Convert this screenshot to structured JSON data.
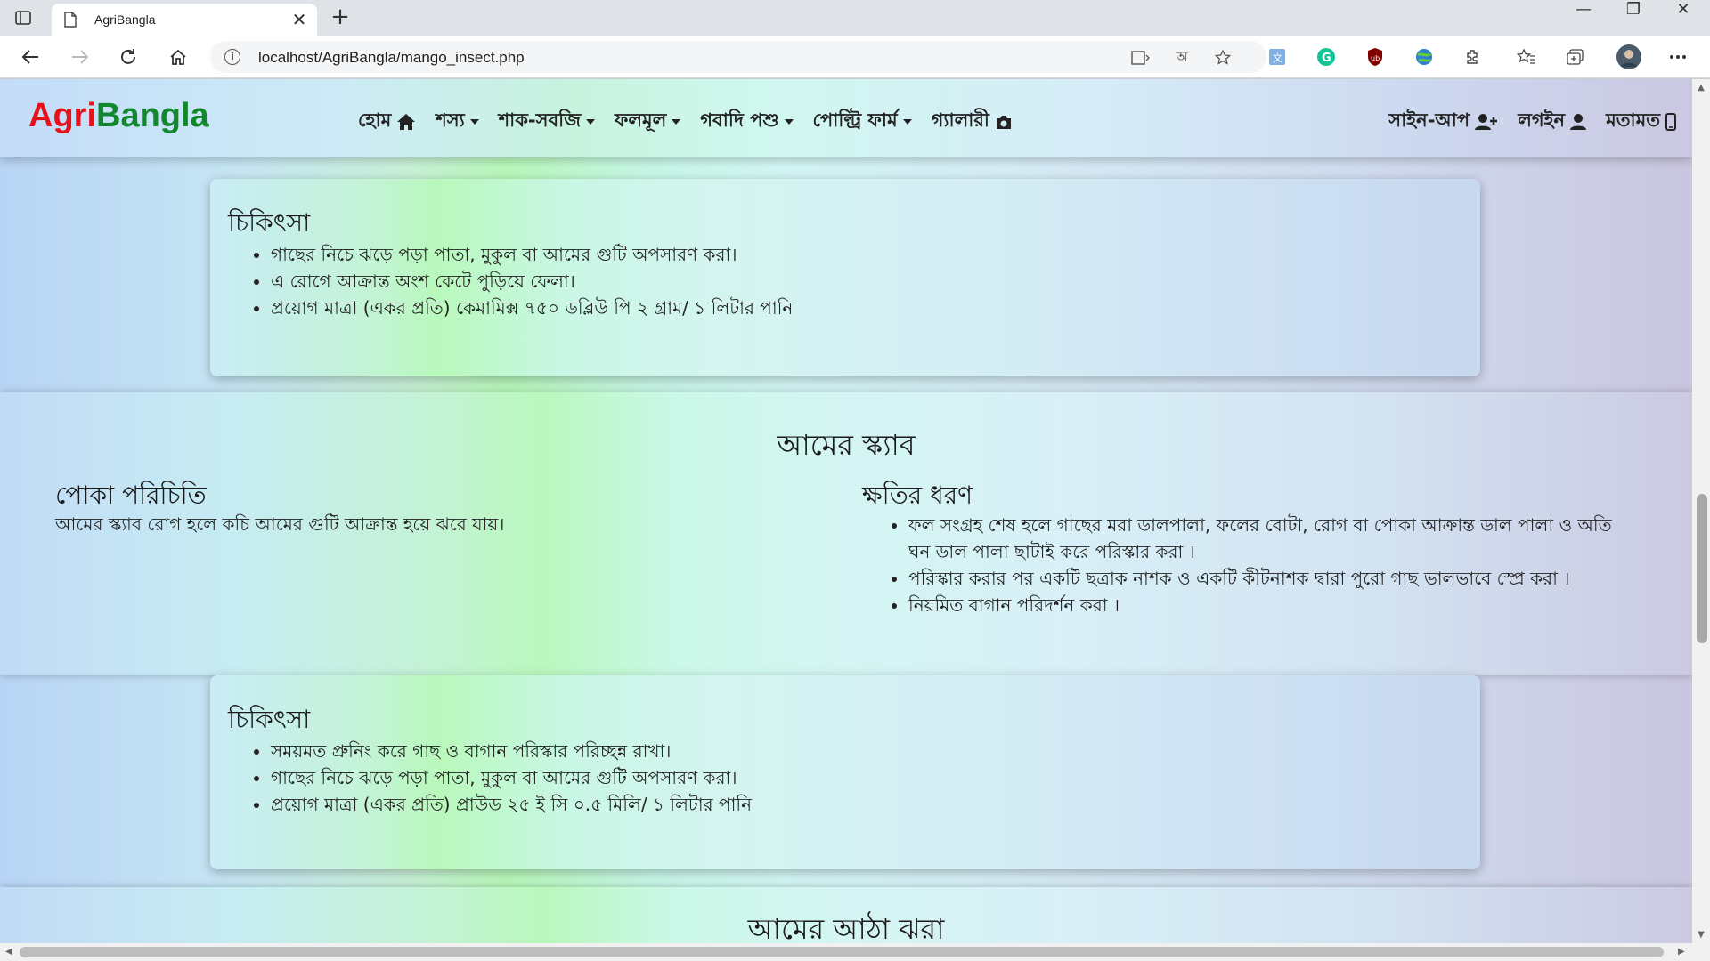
{
  "browser": {
    "tab_title": "AgriBangla",
    "url": "localhost/AgriBangla/mango_insect.php",
    "new_tab_symbol": "+",
    "close_symbol": "✕"
  },
  "navbar": {
    "brand_part1": "Agri",
    "brand_part2": "Bangla",
    "items": [
      {
        "label": "হোম",
        "icon": "home-icon"
      },
      {
        "label": "শস্য",
        "icon": "caret-down-icon"
      },
      {
        "label": "শাক-সবজি",
        "icon": "caret-down-icon"
      },
      {
        "label": "ফলমূল",
        "icon": "caret-down-icon"
      },
      {
        "label": "গবাদি পশু",
        "icon": "caret-down-icon"
      },
      {
        "label": "পোল্ট্রি ফার্ম",
        "icon": "caret-down-icon"
      },
      {
        "label": "গ্যালারী",
        "icon": "camera-icon"
      }
    ],
    "right_items": [
      {
        "label": "সাইন-আপ",
        "icon": "user-plus-icon"
      },
      {
        "label": "লগইন",
        "icon": "user-icon"
      },
      {
        "label": "মতামত",
        "icon": "mobile-icon"
      }
    ]
  },
  "treatment1": {
    "heading": "চিকিৎসা",
    "items": [
      "গাছের নিচে ঝড়ে পড়া পাতা, মুকুল বা আমের গুটি অপসারণ করা।",
      "এ রোগে আক্রান্ত অংশ কেটে পুড়িয়ে ফেলা।",
      "প্রয়োগ মাত্রা (একর প্রতি) কেমামিক্স ৭৫০ ডব্লিউ পি ২ গ্রাম/ ১ লিটার পানি"
    ]
  },
  "scab": {
    "title": "আমের স্ক্যাব",
    "intro_heading": "পোকা পরিচিতি",
    "intro_text": "আমের স্ক্যাব রোগ হলে কচি আমের গুটি আক্রান্ত হয়ে ঝরে যায়।",
    "damage_heading": "ক্ষতির ধরণ",
    "damage_items": [
      "ফল সংগ্রহ শেষ হলে গাছের মরা ডালপালা, ফলের বোটা, রোগ বা পোকা আক্রান্ত ডাল পালা ও অতি ঘন ডাল পালা ছাটাই করে পরিস্কার করা ।",
      "পরিস্কার করার পর একটি ছত্রাক নাশক ও একটি কীটনাশক দ্বারা পুরো গাছ ভালভাবে স্প্রে করা ।",
      "নিয়মিত বাগান পরিদর্শন করা ।"
    ]
  },
  "treatment2": {
    "heading": "চিকিৎসা",
    "items": [
      "সময়মত প্রুনিং করে গাছ ও বাগান পরিস্কার পরিচ্ছন্ন রাখা।",
      "গাছের নিচে ঝড়ে পড়া পাতা, মুকুল বা আমের গুটি অপসারণ করা।",
      "প্রয়োগ মাত্রা (একর প্রতি) প্রাউড ২৫ ই সি ০.৫ মিলি/ ১ লিটার পানি"
    ]
  },
  "next_section": {
    "title": "আমের আঠা ঝরা"
  },
  "colors": {
    "brand_red": "#e8101b",
    "brand_green": "#12872e"
  }
}
